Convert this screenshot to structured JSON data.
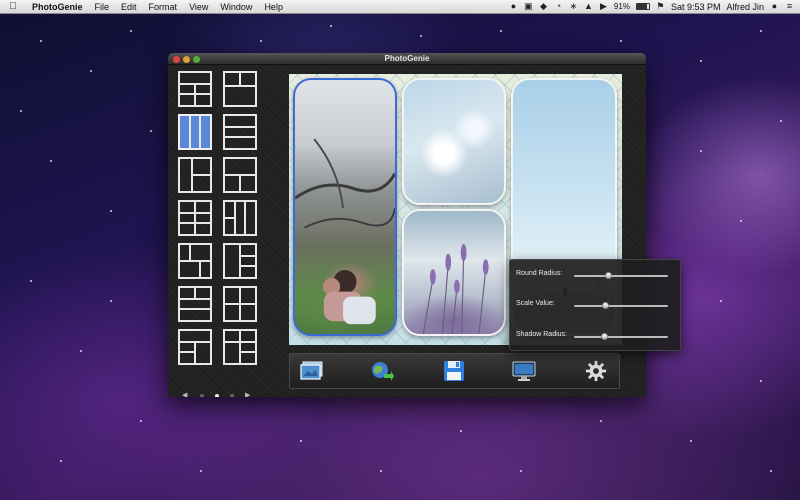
{
  "menubar": {
    "apple_icon": "apple-icon",
    "items": [
      "PhotoGenie",
      "File",
      "Edit",
      "Format",
      "View",
      "Window",
      "Help"
    ],
    "battery": "91%",
    "clock": "Sat 9:53 PM",
    "user": "Alfred Jin"
  },
  "window": {
    "title": "PhotoGenie"
  },
  "layouts": {
    "count": 14,
    "selected_index": 2,
    "pager": {
      "pages": 3,
      "current": 2,
      "prev_icon": "triangle-left-icon",
      "next_icon": "triangle-right-icon"
    }
  },
  "canvas": {
    "photos": [
      "cherry-blossom-couple",
      "white-flowers",
      "lavender-field",
      "sky-landscape"
    ],
    "selected_photo": "cherry-blossom-couple"
  },
  "toolbar": {
    "buttons": [
      {
        "name": "photos-button",
        "icon": "photo-stack-icon"
      },
      {
        "name": "share-button",
        "icon": "globe-share-icon"
      },
      {
        "name": "save-button",
        "icon": "floppy-disk-icon"
      },
      {
        "name": "wallpaper-button",
        "icon": "monitor-icon"
      },
      {
        "name": "settings-button",
        "icon": "gear-icon"
      }
    ]
  },
  "hud": {
    "sliders": [
      {
        "label": "Round Radius:",
        "value": 0.36
      },
      {
        "label": "Scale Value:",
        "value": 0.33
      },
      {
        "label": "Shadow Radius:",
        "value": 0.32
      }
    ]
  },
  "colors": {
    "accent": "#5b87d8",
    "selection_border": "#3b6bd8"
  }
}
